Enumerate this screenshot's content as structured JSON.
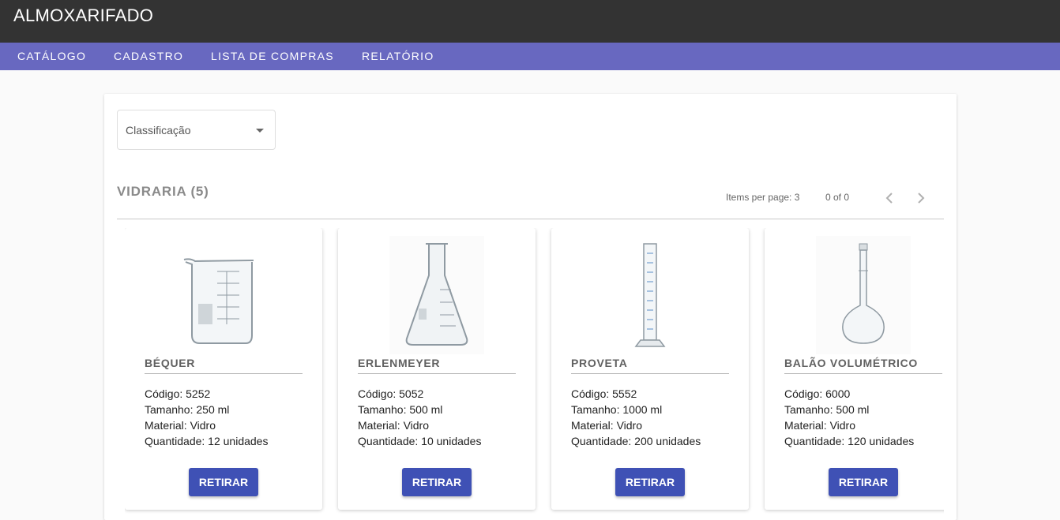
{
  "app": {
    "title": "ALMOXARIFADO"
  },
  "nav": {
    "items": [
      {
        "label": "CATÁLOGO"
      },
      {
        "label": "CADASTRO"
      },
      {
        "label": "LISTA DE COMPRAS"
      },
      {
        "label": "RELATÓRIO"
      }
    ]
  },
  "filter": {
    "placeholder": "Classificação"
  },
  "section": {
    "title": "VIDRARIA (5)"
  },
  "paginator": {
    "items_per_page_label": "Items per page:",
    "items_per_page": "3",
    "range_label": "0 of 0"
  },
  "products": [
    {
      "name": "BÉQUER",
      "codigo": "Código: 5252",
      "tamanho": "Tamanho: 250 ml",
      "material": "Material: Vidro",
      "quantidade": "Quantidade: 12 unidades",
      "button": "RETIRAR",
      "image": "beaker-image"
    },
    {
      "name": "ERLENMEYER",
      "codigo": "Código: 5052",
      "tamanho": "Tamanho: 500 ml",
      "material": "Material: Vidro",
      "quantidade": "Quantidade: 10 unidades",
      "button": "RETIRAR",
      "image": "erlenmeyer-flask-image"
    },
    {
      "name": "PROVETA",
      "codigo": "Código: 5552",
      "tamanho": "Tamanho: 1000 ml",
      "material": "Material: Vidro",
      "quantidade": "Quantidade: 200 unidades",
      "button": "RETIRAR",
      "image": "graduated-cylinder-image"
    },
    {
      "name": "BALÃO VOLUMÉTRICO",
      "codigo": "Código: 6000",
      "tamanho": "Tamanho: 500 ml",
      "material": "Material: Vidro",
      "quantidade": "Quantidade: 120 unidades",
      "button": "RETIRAR",
      "image": "volumetric-flask-image"
    }
  ],
  "colors": {
    "topbar": "#333333",
    "navbar": "#6868c0",
    "primary_button": "#3f51b5"
  }
}
